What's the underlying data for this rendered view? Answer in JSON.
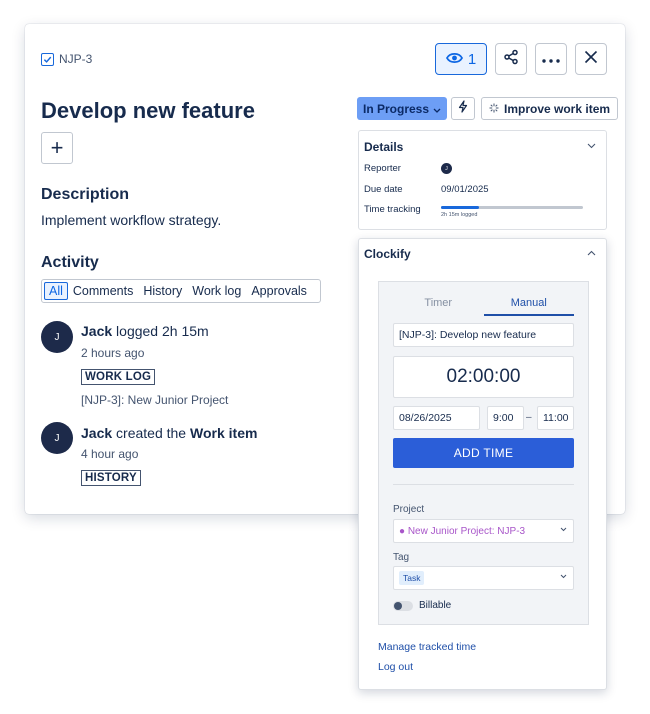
{
  "header": {
    "issue_key": "NJP-3",
    "watch_count": "1"
  },
  "issue": {
    "title": "Develop new feature",
    "add_label": "+",
    "description_heading": "Description",
    "description": "Implement workflow strategy.",
    "activity_heading": "Activity"
  },
  "activity_tabs": [
    "All",
    "Comments",
    "History",
    "Work log",
    "Approvals"
  ],
  "activity": [
    {
      "avatar": "J",
      "user": "Jack",
      "action": "logged 2h 15m",
      "time": "2 hours ago",
      "tag": "WORK LOG",
      "detail": "[NJP-3]: New Junior Project"
    },
    {
      "avatar": "J",
      "user": "Jack",
      "action_prefix": "created the",
      "action_strong": "Work item",
      "time": "4 hour ago",
      "tag": "HISTORY"
    }
  ],
  "toolbar": {
    "status": "In Progress",
    "improve": "Improve work item"
  },
  "details": {
    "heading": "Details",
    "reporter_label": "Reporter",
    "reporter_avatar": "J",
    "due_label": "Due date",
    "due_value": "09/01/2025",
    "time_label": "Time tracking",
    "time_logged": "2h 15m logged",
    "time_progress": 0.27
  },
  "clockify": {
    "heading": "Clockify",
    "tab_timer": "Timer",
    "tab_manual": "Manual",
    "description": "[NJP-3]: Develop new feature",
    "duration": "02:00:00",
    "date": "08/26/2025",
    "start": "9:00",
    "dash": "–",
    "end": "11:00",
    "add_time": "ADD TIME",
    "project_label": "Project",
    "project_value": "● New Junior Project: NJP-3",
    "tag_label": "Tag",
    "tag_value": "Task",
    "billable_label": "Billable",
    "manage_link": "Manage tracked time",
    "logout_link": "Log out"
  },
  "colors": {
    "accent": "#1868db",
    "status_bg": "#6d9ef5",
    "add_time_bg": "#2b5ed8",
    "project_color": "#a855c9",
    "avatar_bg": "#1d2a4a"
  }
}
